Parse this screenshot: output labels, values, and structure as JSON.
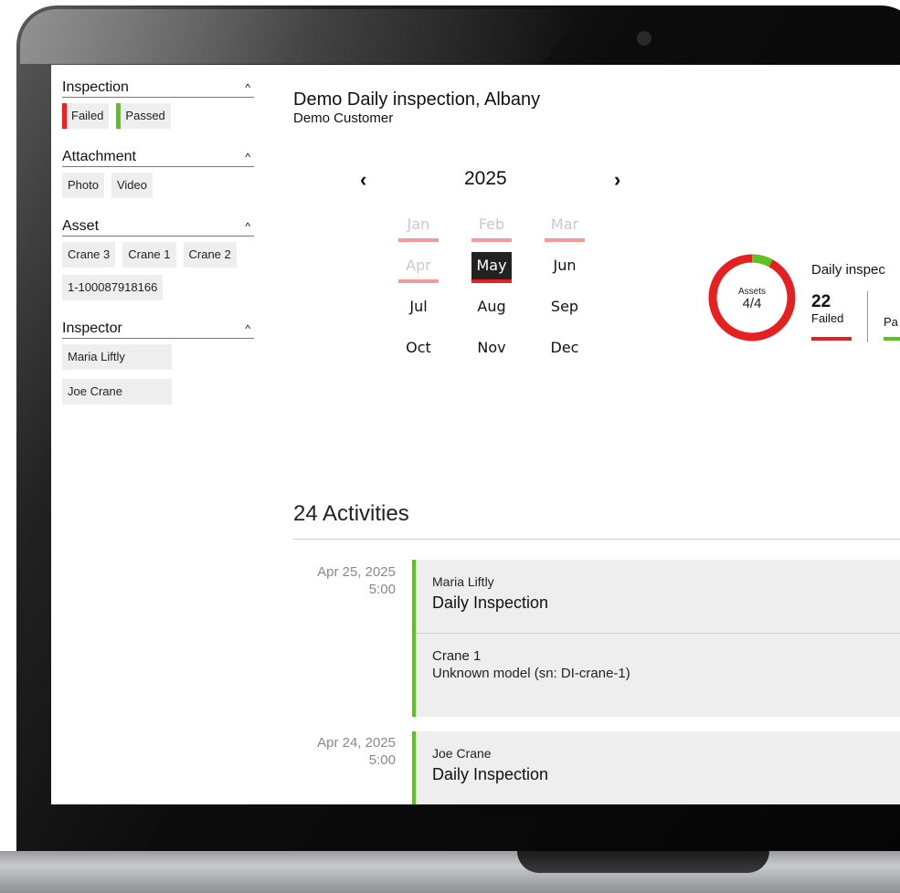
{
  "sidebar": {
    "groups": {
      "inspection": {
        "title": "Inspection",
        "chips": [
          "Failed",
          "Passed"
        ]
      },
      "attachment": {
        "title": "Attachment",
        "chips": [
          "Photo",
          "Video"
        ]
      },
      "asset": {
        "title": "Asset",
        "chips": [
          "Crane 3",
          "Crane 1",
          "Crane 2",
          "1-100087918166"
        ]
      },
      "inspector": {
        "title": "Inspector",
        "chips": [
          "Maria Liftly",
          "Joe Crane"
        ]
      }
    },
    "caret": "^"
  },
  "header": {
    "title": "Demo Daily inspection, Albany",
    "subtitle": "Demo Customer"
  },
  "calendar": {
    "prev": "‹",
    "next": "›",
    "year": "2025",
    "months": [
      "Jan",
      "Feb",
      "Mar",
      "Apr",
      "May",
      "Jun",
      "Jul",
      "Aug",
      "Sep",
      "Oct",
      "Nov",
      "Dec"
    ],
    "selected_month": "May"
  },
  "summary": {
    "donut_label": "Assets",
    "donut_value": "4/4",
    "passed_fraction": 0.08,
    "title": "Daily inspec",
    "failed_count": "22",
    "failed_label": "Failed",
    "passed_label": "Pa",
    "colors": {
      "failed": "#e62020",
      "passed": "#5cc420"
    }
  },
  "activities": {
    "title": "24 Activities",
    "items": [
      {
        "date": "Apr 25, 2025",
        "time": "5:00",
        "person": "Maria Liftly",
        "kind": "Daily Inspection",
        "asset": "Crane 1",
        "model": "Unknown model (sn: DI-crane-1)"
      },
      {
        "date": "Apr 24, 2025",
        "time": "5:00",
        "person": "Joe Crane",
        "kind": "Daily Inspection"
      }
    ]
  }
}
